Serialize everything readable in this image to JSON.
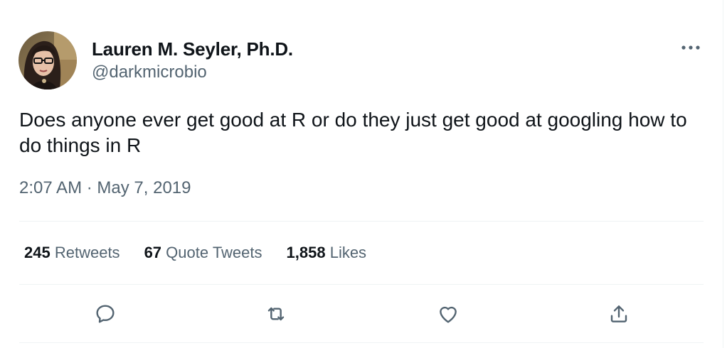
{
  "author": {
    "display_name": "Lauren M. Seyler, Ph.D.",
    "handle": "@darkmicrobio"
  },
  "tweet": {
    "text": "Does anyone ever get good at R or do they just get good at googling how to do things in R",
    "time": "2:07 AM",
    "separator": "·",
    "date": "May 7, 2019"
  },
  "stats": {
    "retweets_count": "245",
    "retweets_label": "Retweets",
    "quotes_count": "67",
    "quotes_label": "Quote Tweets",
    "likes_count": "1,858",
    "likes_label": "Likes"
  },
  "icons": {
    "more": "more-horizontal-icon",
    "reply": "reply-bubble-icon",
    "retweet": "retweet-arrows-icon",
    "like": "heart-icon",
    "share": "share-upload-icon"
  },
  "colors": {
    "text_primary": "#0f1419",
    "text_secondary": "#536471",
    "divider": "#eff3f4"
  }
}
